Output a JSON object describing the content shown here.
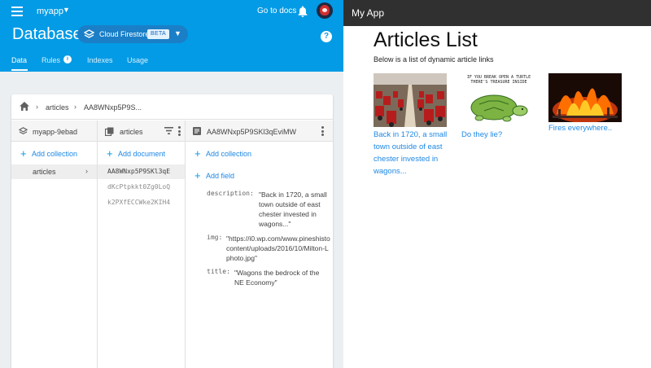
{
  "firebase": {
    "project": "myapp",
    "goto_docs": "Go to docs",
    "title": "Database",
    "db_selector": {
      "label": "Cloud Firestore",
      "badge": "BETA"
    },
    "tabs": [
      {
        "label": "Data",
        "active": true
      },
      {
        "label": "Rules",
        "badge": "i"
      },
      {
        "label": "Indexes"
      },
      {
        "label": "Usage"
      }
    ],
    "breadcrumb": [
      "articles",
      "AA8WNxp5P9S..."
    ],
    "columns": {
      "root": {
        "header": "myapp-9ebad",
        "add_label": "Add collection",
        "items": [
          {
            "label": "articles",
            "selected": true
          }
        ]
      },
      "collection": {
        "header": "articles",
        "add_label": "Add document",
        "items": [
          {
            "label": "AA8WNxp5P9SKl3qE",
            "selected": true
          },
          {
            "label": "dKcPtpkkt0Zg0LoQ"
          },
          {
            "label": "k2PXfECCWke2KIH4"
          }
        ]
      },
      "document": {
        "header": "AA8WNxp5P9SKl3qEviMW",
        "add_collection": "Add collection",
        "add_field": "Add field",
        "fields": [
          {
            "key": "description:",
            "value": "\"Back in 1720, a small town outside of east chester invested in wagons...\""
          },
          {
            "key": "img:",
            "value": "\"https://i0.wp.com/www.pineshisto content/uploads/2016/10/Milton-L photo.jpg\""
          },
          {
            "key": "title:",
            "value": "\"Wagons the bedrock of the NE Economy\""
          }
        ]
      }
    }
  },
  "app": {
    "title": "My App",
    "heading": "Articles List",
    "subheading": "Below is a list of dynamic article links",
    "articles": [
      {
        "link": "Back in 1720, a small town outside of east chester invested in wagons..."
      },
      {
        "link": "Do they lie?",
        "image_text": "IF YOU BREAK OPEN A TURTLE THERE'S TREASURE INSIDE"
      },
      {
        "link": "Fires everywhere.."
      }
    ]
  },
  "colors": {
    "firebase_blue": "#039be5",
    "link_blue": "#1e88e5",
    "app_bar": "#303030"
  }
}
